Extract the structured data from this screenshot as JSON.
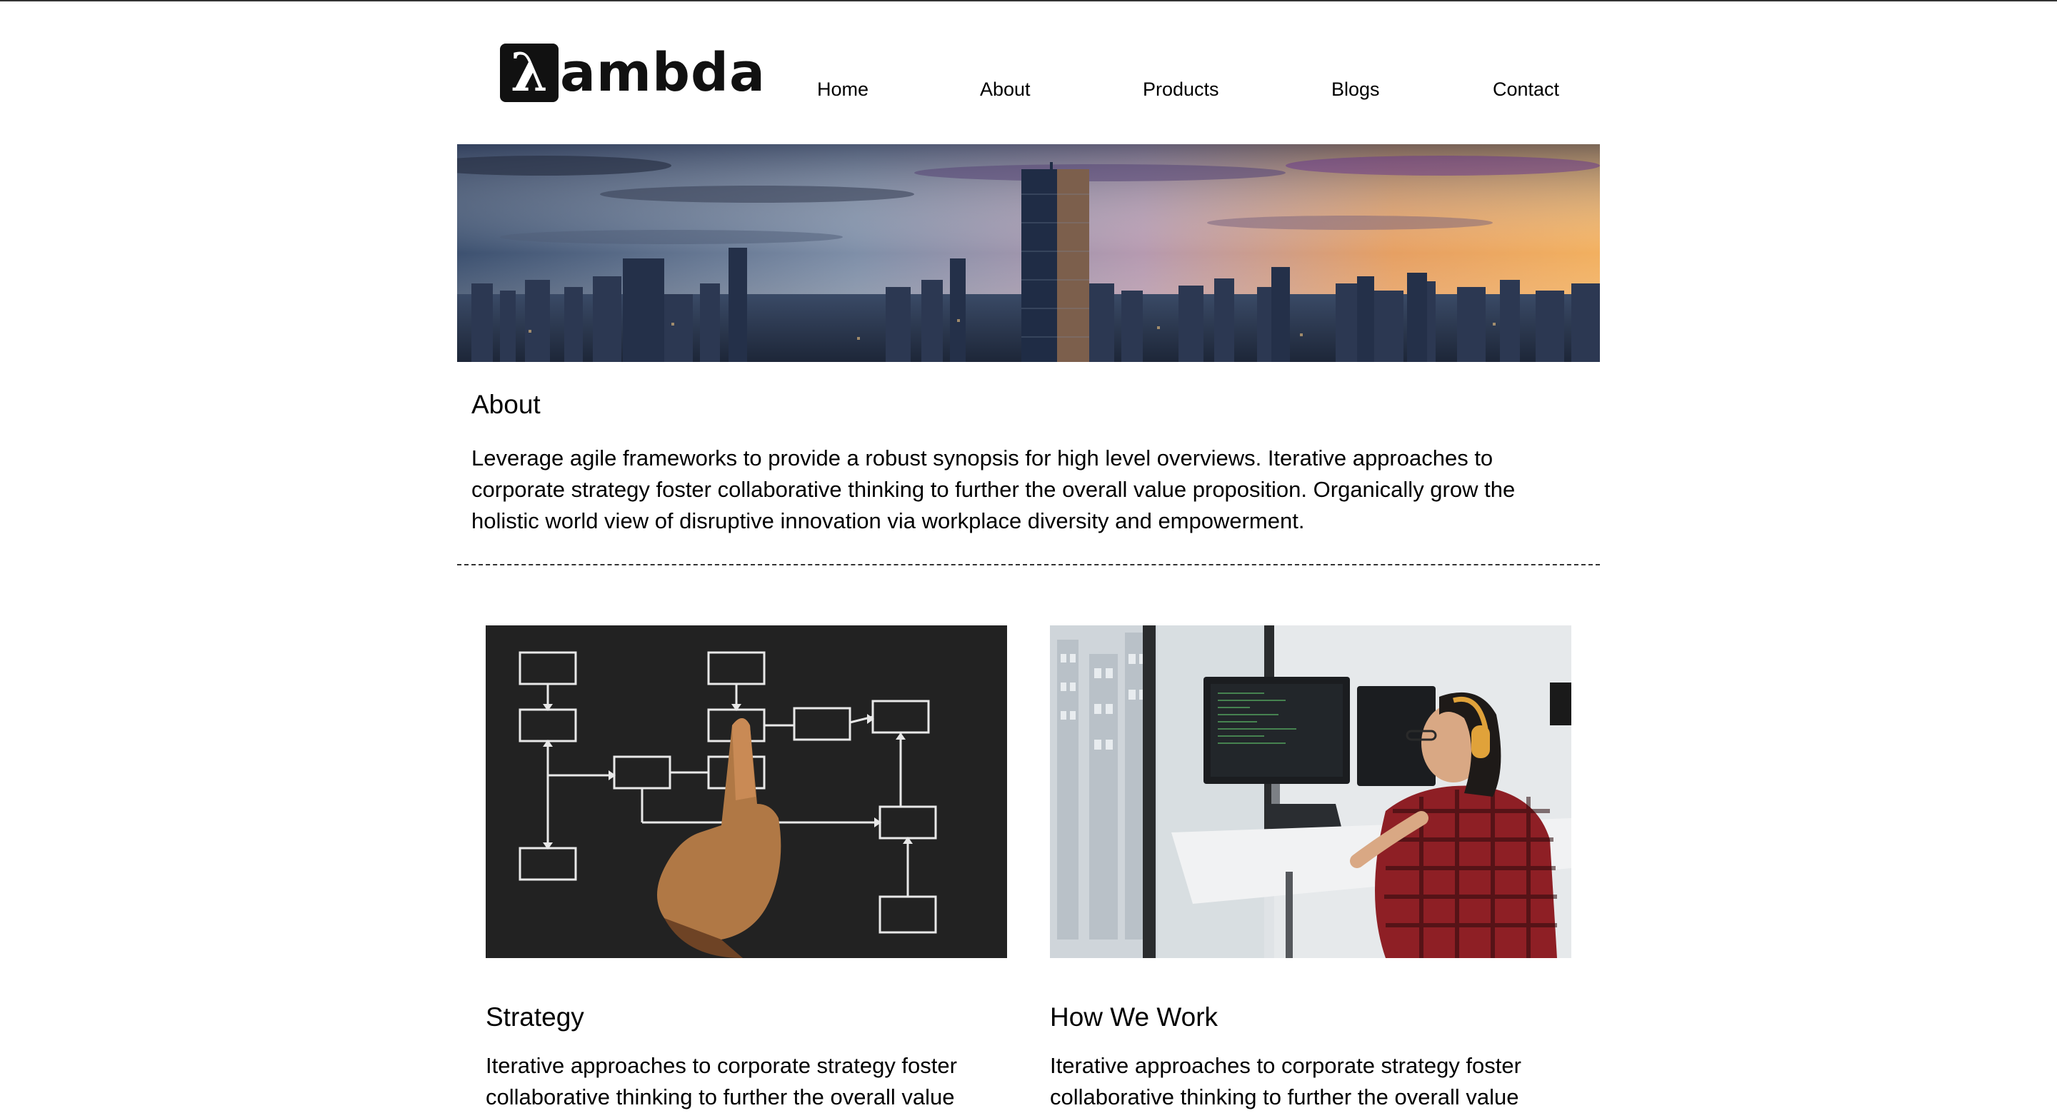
{
  "header": {
    "logo": {
      "mark": "λ",
      "text": "ambda"
    },
    "nav": [
      {
        "label": "Home"
      },
      {
        "label": "About"
      },
      {
        "label": "Products"
      },
      {
        "label": "Blogs"
      },
      {
        "label": "Contact"
      }
    ]
  },
  "hero": {
    "image": "city-skyline-sunset-image"
  },
  "about": {
    "title": "About",
    "text": "Leverage agile frameworks to provide a robust synopsis for high level overviews. Iterative approaches to corporate strategy foster collaborative thinking to further the overall value proposition. Organically grow the holistic world view of disruptive innovation via workplace diversity and empowerment."
  },
  "cards": [
    {
      "image": "chalkboard-flowchart-image",
      "title": "Strategy",
      "text": "Iterative approaches to corporate strategy foster collaborative thinking to further the overall value"
    },
    {
      "image": "developer-at-workstation-image",
      "title": "How We Work",
      "text": "Iterative approaches to corporate strategy foster collaborative thinking to further the overall value"
    }
  ],
  "colors": {
    "text": "#000000",
    "background": "#ffffff",
    "divider": "#333333",
    "chalkboard": "#222222"
  }
}
